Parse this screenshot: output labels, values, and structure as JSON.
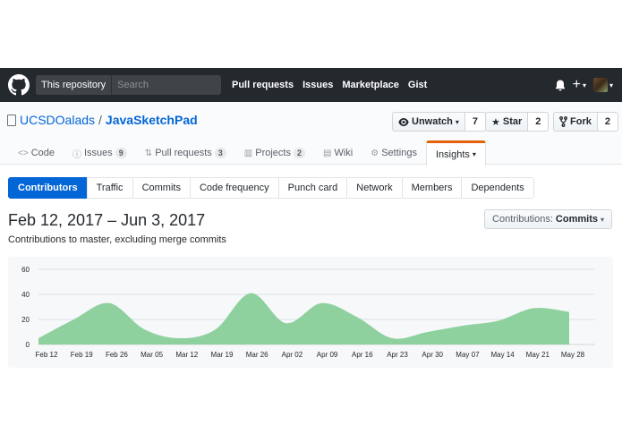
{
  "header": {
    "scope_label": "This repository",
    "search_placeholder": "Search",
    "nav": [
      "Pull requests",
      "Issues",
      "Marketplace",
      "Gist"
    ],
    "plus_label": "+",
    "caret": "▾"
  },
  "repo": {
    "owner": "UCSDOalads",
    "separator": "/",
    "name": "JavaSketchPad",
    "watch_label": "Unwatch",
    "watch_count": "7",
    "star_label": "Star",
    "star_count": "2",
    "fork_label": "Fork",
    "fork_count": "2"
  },
  "tabs": [
    {
      "label": "Code",
      "icon": "code-icon"
    },
    {
      "label": "Issues",
      "counter": "9",
      "icon": "issue-icon"
    },
    {
      "label": "Pull requests",
      "counter": "3",
      "icon": "pull-request-icon"
    },
    {
      "label": "Projects",
      "counter": "2",
      "icon": "project-icon"
    },
    {
      "label": "Wiki",
      "icon": "book-icon"
    },
    {
      "label": "Settings",
      "icon": "gear-icon"
    },
    {
      "label": "Insights",
      "icon": "caret-icon"
    }
  ],
  "subnav": [
    "Contributors",
    "Traffic",
    "Commits",
    "Code frequency",
    "Punch card",
    "Network",
    "Members",
    "Dependents"
  ],
  "range_title": "Feb 12, 2017 – Jun 3, 2017",
  "range_subtitle": "Contributions to master, excluding merge commits",
  "dropdown": {
    "prefix": "Contributions:",
    "value": "Commits"
  },
  "colors": {
    "header_bg": "#24292e",
    "accent": "#0366d6",
    "tab_highlight": "#e36209",
    "area_fill": "#8fd19e"
  },
  "chart_data": {
    "type": "area",
    "x": [
      "Feb 12",
      "Feb 19",
      "Feb 26",
      "Mar 05",
      "Mar 12",
      "Mar 19",
      "Mar 26",
      "Apr 02",
      "Apr 09",
      "Apr 16",
      "Apr 23",
      "Apr 30",
      "May 07",
      "May 14",
      "May 21",
      "May 28"
    ],
    "values": [
      5,
      20,
      33,
      12,
      5,
      12,
      41,
      17,
      33,
      22,
      5,
      10,
      15,
      19,
      29,
      26
    ],
    "yticks": [
      0,
      20,
      40,
      60
    ],
    "ylim": [
      0,
      60
    ],
    "grid": true
  }
}
